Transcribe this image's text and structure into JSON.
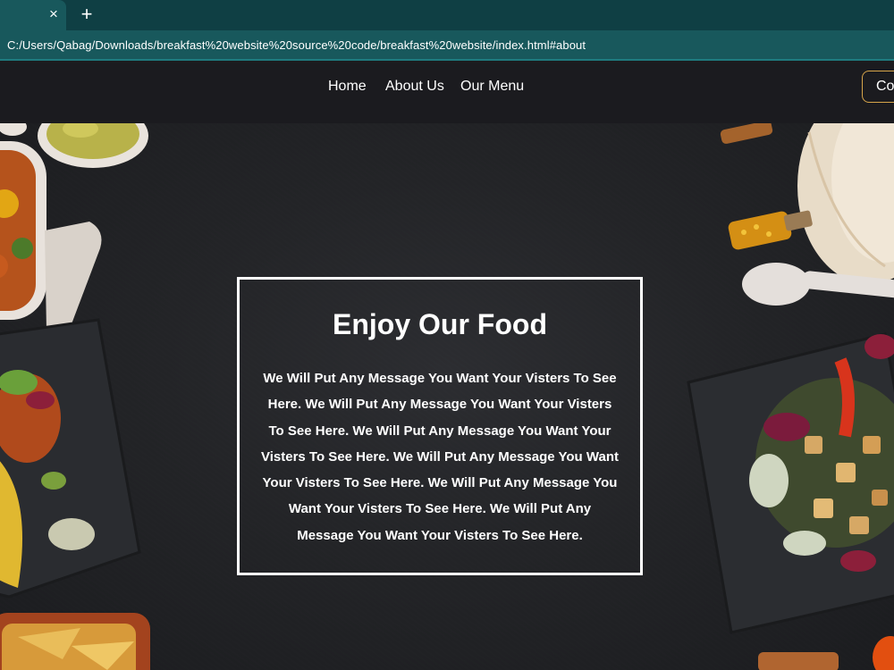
{
  "browser": {
    "tab_close_glyph": "×",
    "new_tab_glyph": "+",
    "url": "C:/Users/Qabag/Downloads/breakfast%20website%20source%20code/breakfast%20website/index.html#about"
  },
  "nav": {
    "home": "Home",
    "about": "About Us",
    "menu": "Our Menu",
    "contact": "Co"
  },
  "hero": {
    "title": "Enjoy Our Food",
    "body": "We Will Put Any Message You Want Your Visters To See Here. We Will Put Any Message You Want Your Visters To See Here. We Will Put Any Message You Want Your Visters To See Here. We Will Put Any Message You Want Your Visters To See Here. We Will Put Any Message You Want Your Visters To See Here. We Will Put Any Message You Want Your Visters To See Here."
  },
  "colors": {
    "tabstrip": "#0f3f44",
    "address_bar": "#18585c",
    "navbar": "#1b1b1f",
    "contact_border": "#d6a44a",
    "hero_border": "#ffffff"
  }
}
